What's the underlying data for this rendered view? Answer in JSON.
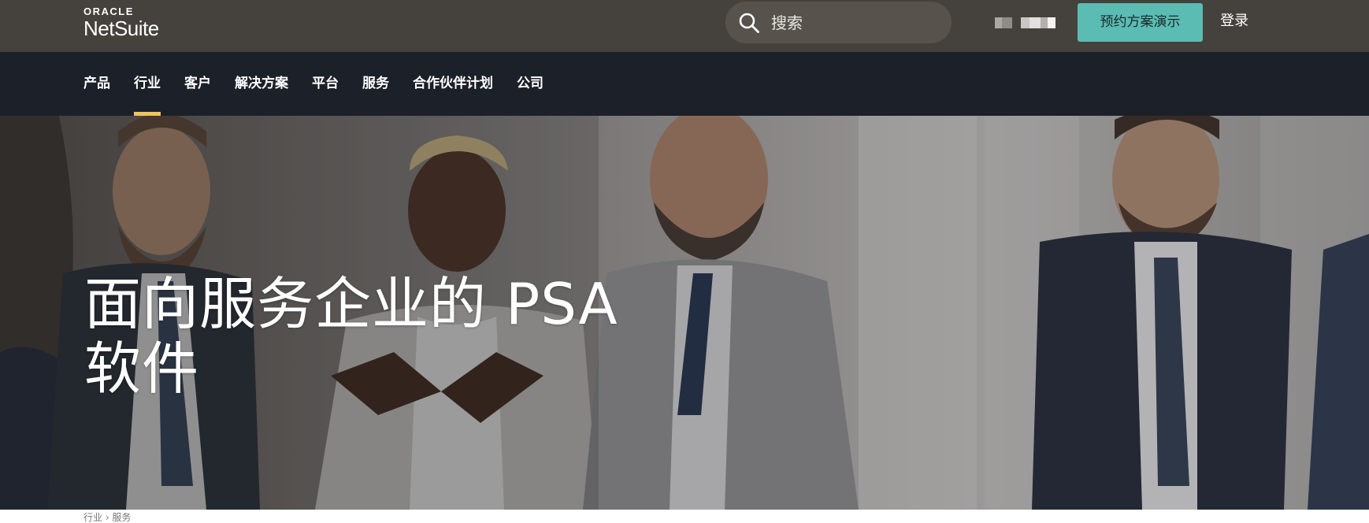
{
  "header": {
    "logo": {
      "top": "ORACLE",
      "bottom": "NetSuite"
    },
    "search": {
      "placeholder": "搜索",
      "icon": "search-icon"
    },
    "demo_button": "预约方案演示",
    "login": "登录"
  },
  "nav": {
    "items": [
      {
        "label": "产品",
        "active": false
      },
      {
        "label": "行业",
        "active": true
      },
      {
        "label": "客户",
        "active": false
      },
      {
        "label": "解决方案",
        "active": false
      },
      {
        "label": "平台",
        "active": false
      },
      {
        "label": "服务",
        "active": false
      },
      {
        "label": "合作伙伴计划",
        "active": false
      },
      {
        "label": "公司",
        "active": false
      }
    ]
  },
  "hero": {
    "title_line1": "面向服务企业的 PSA",
    "title_line2": "软件"
  },
  "breadcrumb": "行业 › 服务",
  "colors": {
    "topbar": "#45413c",
    "navbar": "#1c2028",
    "accent": "#5bbcb3",
    "nav_active_underline": "#f0c35c"
  }
}
